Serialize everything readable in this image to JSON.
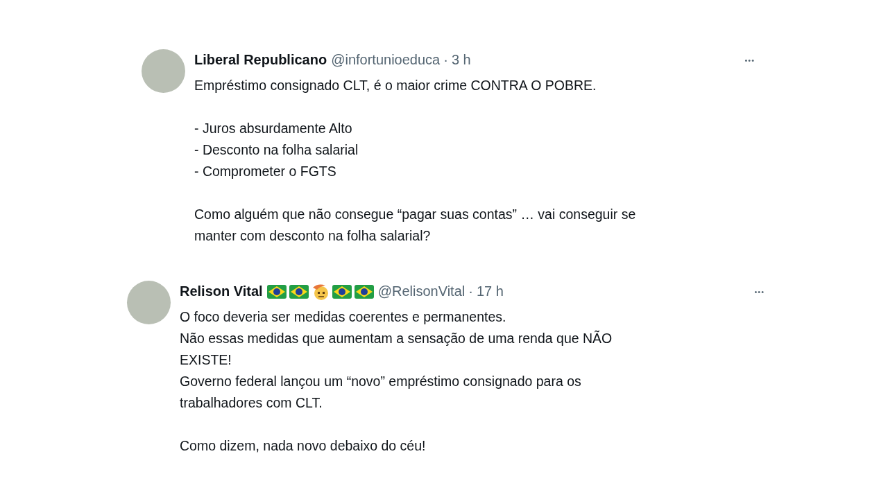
{
  "tweets": [
    {
      "name": "Liberal Republicano",
      "handle": "@infortunioeduca",
      "separator": "·",
      "time": "3 h",
      "more": "•••",
      "text": "Empréstimo consignado CLT, é o maior crime CONTRA O POBRE.\n\n- Juros absurdamente Alto\n- Desconto na folha salarial\n- Comprometer o FGTS\n\nComo alguém que não consegue “pagar suas contas” … vai conseguir se\nmanter com desconto na folha salarial?"
    },
    {
      "name": "Relison Vital",
      "name_emoji": [
        {
          "kind": "flag"
        },
        {
          "kind": "flag"
        },
        {
          "kind": "face"
        },
        {
          "kind": "flag"
        },
        {
          "kind": "flag"
        }
      ],
      "handle": "@RelisonVital",
      "separator": "·",
      "time": "17 h",
      "more": "•••",
      "text": "O foco deveria ser medidas coerentes e permanentes.\nNão essas medidas que aumentam a sensação de uma renda que NÃO\nEXISTE!\nGoverno federal lançou um “novo” empréstimo consignado para os\ntrabalhadores com CLT.\n\nComo dizem, nada novo debaixo do céu!"
    }
  ]
}
